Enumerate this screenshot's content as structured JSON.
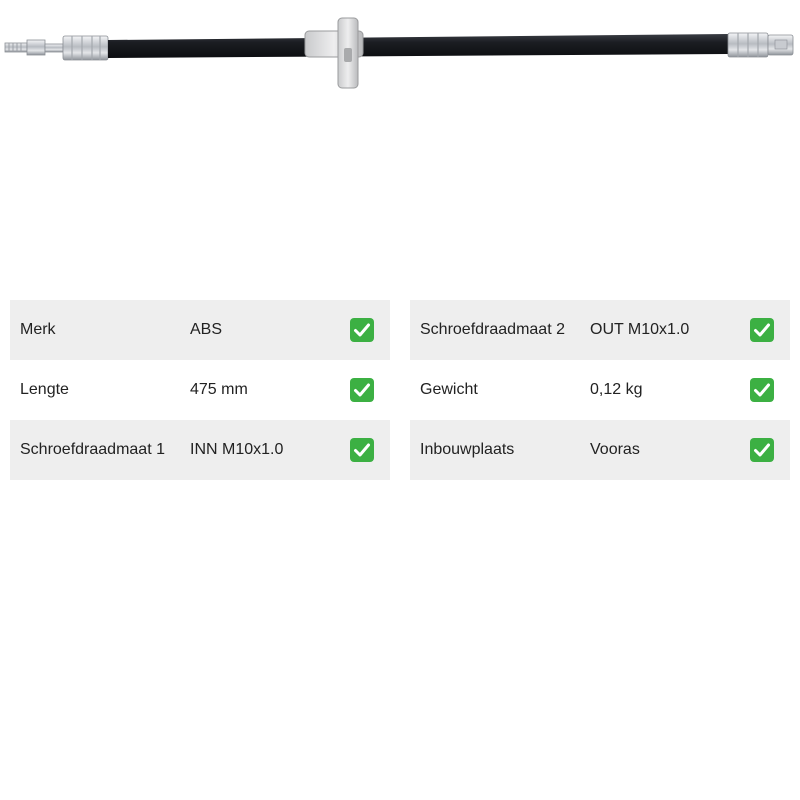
{
  "product": {
    "image_icon": "brake-hose-photo"
  },
  "spec_left": [
    {
      "label": "Merk",
      "value": "ABS"
    },
    {
      "label": "Lengte",
      "value": "475 mm"
    },
    {
      "label": "Schroefdraadmaat 1",
      "value": "INN M10x1.0"
    }
  ],
  "spec_right": [
    {
      "label": "Schroefdraadmaat 2",
      "value": "OUT M10x1.0"
    },
    {
      "label": "Gewicht",
      "value": "0,12 kg"
    },
    {
      "label": "Inbouwplaats",
      "value": "Vooras"
    }
  ],
  "colors": {
    "row_shade": "#eeeeee",
    "check_green": "#3cb043",
    "hose": "#1b1d22",
    "fitting": "#c9ccd1"
  },
  "icons": {
    "check": "check-mark-icon"
  }
}
